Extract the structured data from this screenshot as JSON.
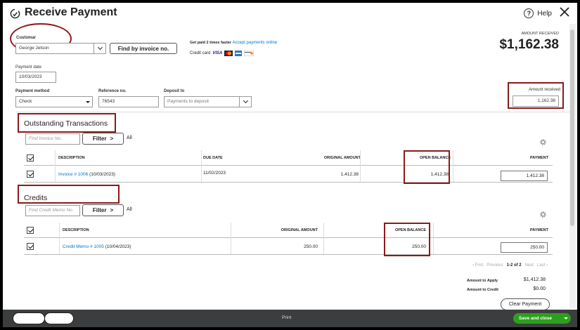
{
  "header": {
    "title": "Receive Payment",
    "help_label": "Help",
    "help_symbol": "?"
  },
  "customer": {
    "label": "Customar",
    "value": "George Jetson",
    "find_invoice_button": "Find by invoice no."
  },
  "promo": {
    "text": "Get paid 2 times faster",
    "link": "Accept payments online",
    "credit_card_label": "Credit card",
    "visa": "VISA"
  },
  "amount_received_top": {
    "label": "AMOUNT RECEIVED",
    "value": "$1,162.38"
  },
  "payment_date": {
    "label": "Payment date",
    "value": "10/03/2023"
  },
  "payment_method": {
    "label": "Payment method",
    "value": "Check"
  },
  "reference": {
    "label": "Reference no.",
    "value": "76543"
  },
  "deposit_to": {
    "label": "Deposit to",
    "placeholder": "Payments to deposit"
  },
  "amount_received_field": {
    "label": "Amount received",
    "value": "1,162.38"
  },
  "outstanding": {
    "title": "Outstanding Transactions",
    "search_placeholder": "Find Invoice No.",
    "filter_label": "Filter",
    "filter_arrow": ">",
    "all_label": "All",
    "columns": [
      "DESCRIPTION",
      "DUE DATE",
      "ORIGINAL AMOUNT",
      "OPEN BALANCE",
      "PAYMENT"
    ],
    "rows": [
      {
        "link": "Invoice # 1006",
        "date_paren": "(10/03/2023)",
        "due_date": "11/02/2023",
        "original_amount": "1,412.38",
        "open_balance": "1,412.38",
        "payment": "1,412.38"
      }
    ]
  },
  "credits": {
    "title": "Credits",
    "search_placeholder": "Find Credit Memo No.",
    "filter_label": "Filter",
    "filter_arrow": ">",
    "all_label": "All",
    "columns": [
      "DESCRIPTION",
      "ORIGINAL AMOUNT",
      "OPEN BALANCE",
      "PAYMENT"
    ],
    "rows": [
      {
        "link": "Credit Memo # 1005",
        "date_paren": "(10/04/2023)",
        "original_amount": "250.00",
        "open_balance": "250.00",
        "payment": "250.00"
      }
    ]
  },
  "pagination": {
    "first": "‹ First",
    "previous": "Previous",
    "range": "1-2 of 2",
    "next": "Next",
    "last": "Last ›"
  },
  "totals": {
    "apply_label": "Amount to Apply",
    "apply_value": "$1,412.38",
    "credit_label": "Amount to Credit",
    "credit_value": "$0.00"
  },
  "clear_payment": "Clear Payment",
  "footer": {
    "print": "Print",
    "save": "Save and close"
  }
}
